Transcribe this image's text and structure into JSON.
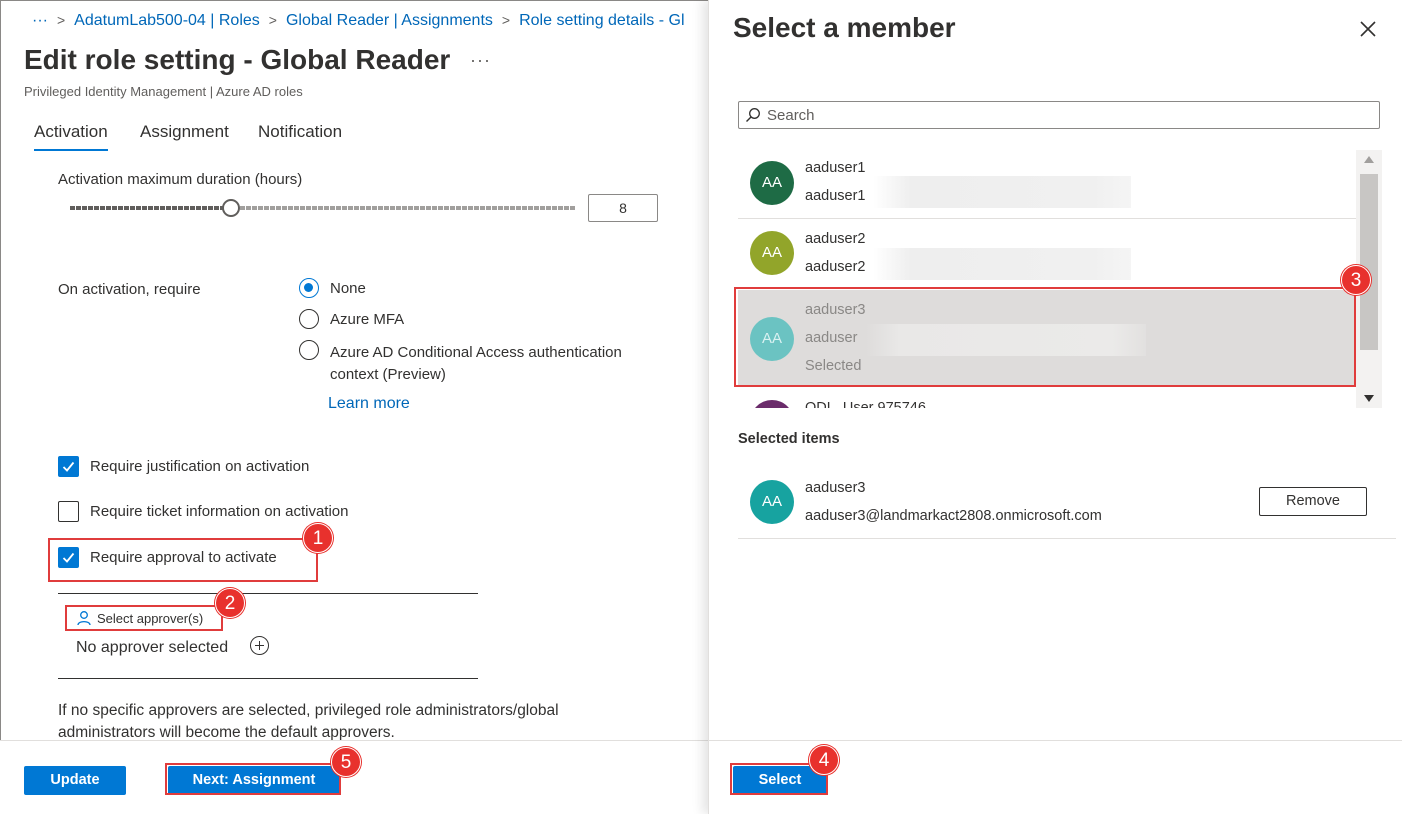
{
  "breadcrumb": {
    "more": "···",
    "items": [
      "AdatumLab500-04 | Roles",
      "Global Reader | Assignments",
      "Role setting details - Gl"
    ]
  },
  "page": {
    "title": "Edit role setting - Global Reader",
    "more": "···",
    "subtitle": "Privileged Identity Management | Azure AD roles"
  },
  "tabs": [
    "Activation",
    "Assignment",
    "Notification"
  ],
  "activation": {
    "duration_label": "Activation maximum duration (hours)",
    "duration_value": "8",
    "require_label": "On activation, require",
    "options": [
      {
        "label": "None",
        "selected": true
      },
      {
        "label": "Azure MFA",
        "selected": false
      },
      {
        "label": "Azure AD Conditional Access authentication context (Preview)",
        "selected": false
      }
    ],
    "learn_more": "Learn more",
    "checks": [
      {
        "label": "Require justification on activation",
        "checked": true
      },
      {
        "label": "Require ticket information on activation",
        "checked": false
      },
      {
        "label": "Require approval to activate",
        "checked": true
      }
    ],
    "select_approvers": "Select approver(s)",
    "no_approver": "No approver selected",
    "note": "If no specific approvers are selected, privileged role administrators/global administrators will become the default approvers."
  },
  "footer_left": {
    "update": "Update",
    "next": "Next: Assignment"
  },
  "panel": {
    "title": "Select a member",
    "search_placeholder": "Search",
    "members": [
      {
        "initials": "AA",
        "name": "aaduser1",
        "mail": "aaduser1",
        "color": "#1e6b45"
      },
      {
        "initials": "AA",
        "name": "aaduser2",
        "mail": "aaduser2",
        "color": "#92a52a"
      },
      {
        "initials": "AA",
        "name": "aaduser3",
        "mail": "aaduser",
        "status": "Selected",
        "color": "#6bc3c2"
      },
      {
        "initials": "",
        "name": "ODL_User 975746",
        "mail": "",
        "color": "#6b2c6b"
      }
    ],
    "selected_label": "Selected items",
    "selected_item": {
      "initials": "AA",
      "name": "aaduser3",
      "mail": "aaduser3@landmarkact2808.onmicrosoft.com",
      "color": "#17a3a0"
    },
    "remove": "Remove",
    "select": "Select"
  },
  "callouts": [
    "1",
    "2",
    "3",
    "4",
    "5"
  ],
  "colors": {
    "accent": "#0078d4",
    "callout": "#e03c3c"
  }
}
